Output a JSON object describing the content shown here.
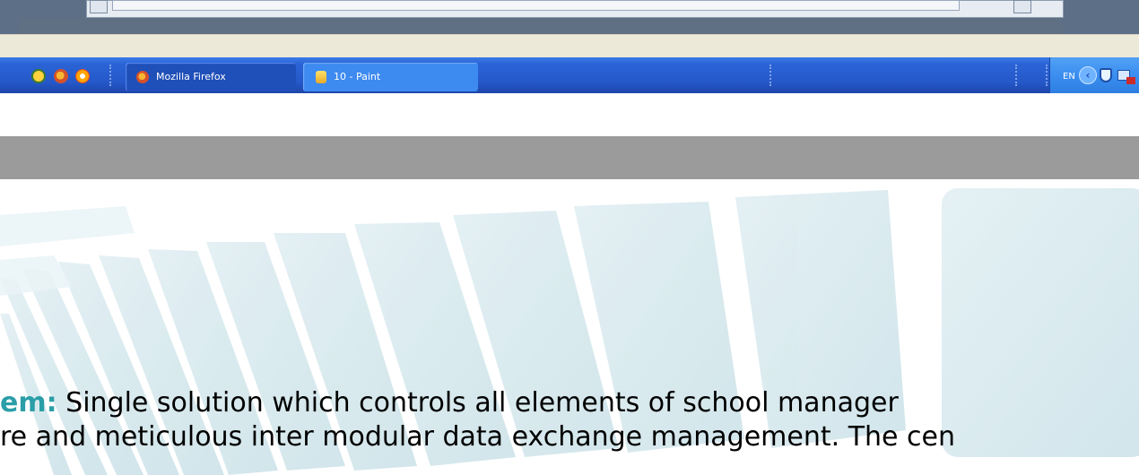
{
  "taskbar": {
    "quick_launch": [
      "security-center-icon",
      "firefox-icon",
      "ie-icon"
    ],
    "tasks": [
      {
        "label": "Mozilla Firefox",
        "icon": "firefox-icon"
      },
      {
        "label": "10 - Paint",
        "icon": "paint-icon"
      }
    ],
    "tray": {
      "language": "EN",
      "arrow": "‹",
      "icons": [
        "shield-icon",
        "monitor-icon"
      ]
    }
  },
  "slide": {
    "keyword": "em:",
    "line1_rest": " Single solution which controls all elements of school manager",
    "line2": "re and meticulous inter modular data exchange management. The cen"
  },
  "colors": {
    "taskbar": "#2558c9",
    "task_active": "#3d8af0",
    "accent_text": "#2b9ea8",
    "gray_band": "#9b9b9b"
  }
}
